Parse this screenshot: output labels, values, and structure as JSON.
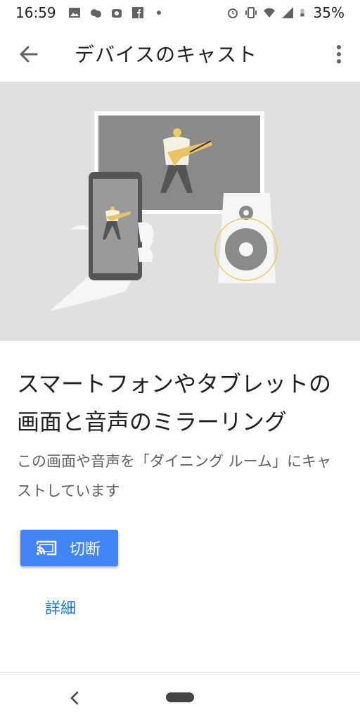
{
  "status_bar": {
    "time": "16:59",
    "battery": "35%",
    "left_icons": [
      "image-icon",
      "weather-icon",
      "app-icon",
      "facebook-icon",
      "dot-icon"
    ],
    "right_icons": [
      "alarm-icon",
      "vibrate-icon",
      "wifi-icon",
      "signal-icon",
      "battery-icon"
    ]
  },
  "app_bar": {
    "title": "デバイスのキャスト",
    "back_icon": "arrow-back-icon",
    "menu_icon": "more-vert-icon"
  },
  "content": {
    "heading": "スマートフォンやタブレットの画面と音声のミラーリング",
    "subtitle": "この画面や音声を「ダイニング ルーム」にキャストしています",
    "disconnect_button": {
      "label": "切断",
      "icon": "cast-connected-icon"
    },
    "details_link": "詳細"
  },
  "colors": {
    "accent": "#4285f4",
    "link": "#1a73e8",
    "hero_background": "#e0e0e0",
    "illustration_accent": "#f3c860"
  },
  "nav_bar": {
    "back_icon": "nav-back-icon",
    "home_icon": "nav-home-pill"
  }
}
